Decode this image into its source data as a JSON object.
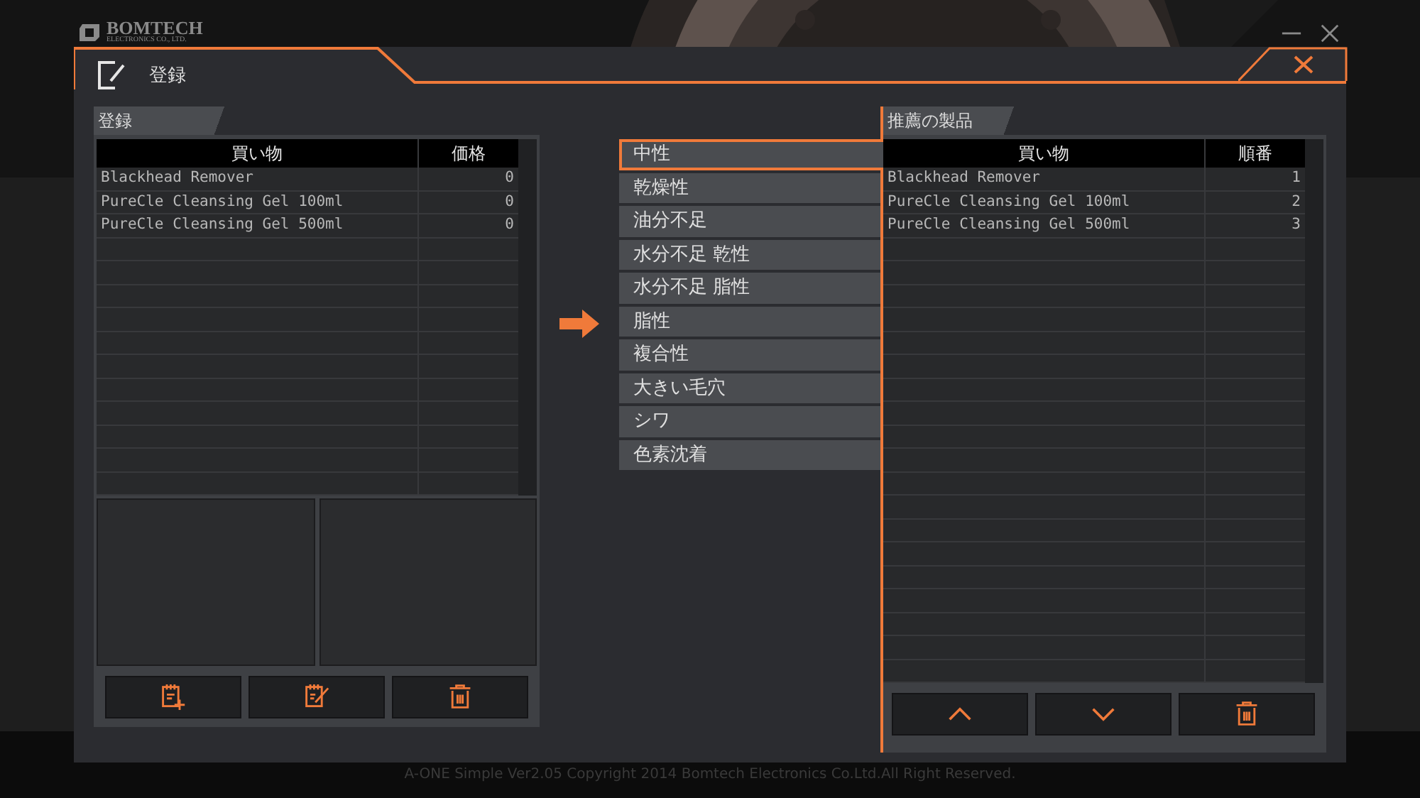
{
  "app": {
    "logo": "BOMTECH",
    "logo_subtitle": "ELECTRONICS CO., LTD."
  },
  "dialog": {
    "title": "登録"
  },
  "left_panel": {
    "tab": "登録",
    "columns": [
      "買い物",
      "価格"
    ],
    "rows": [
      {
        "name": "Blackhead Remover",
        "value": "0"
      },
      {
        "name": "PureCle Cleansing Gel 100ml",
        "value": "0"
      },
      {
        "name": "PureCle Cleansing Gel 500ml",
        "value": "0"
      }
    ],
    "buttons": [
      {
        "kind": "add"
      },
      {
        "kind": "edit"
      },
      {
        "kind": "delete"
      }
    ]
  },
  "skin_types": [
    {
      "label": "中性",
      "selected": true
    },
    {
      "label": "乾燥性",
      "selected": false
    },
    {
      "label": "油分不足",
      "selected": false
    },
    {
      "label": "水分不足 乾性",
      "selected": false
    },
    {
      "label": "水分不足 脂性",
      "selected": false
    },
    {
      "label": "脂性",
      "selected": false
    },
    {
      "label": "複合性",
      "selected": false
    },
    {
      "label": "大きい毛穴",
      "selected": false
    },
    {
      "label": "シワ",
      "selected": false
    },
    {
      "label": "色素沈着",
      "selected": false
    }
  ],
  "right_panel": {
    "tab": "推薦の製品",
    "columns": [
      "買い物",
      "順番"
    ],
    "rows": [
      {
        "name": "Blackhead Remover",
        "value": "1"
      },
      {
        "name": "PureCle Cleansing Gel 100ml",
        "value": "2"
      },
      {
        "name": "PureCle Cleansing Gel 500ml",
        "value": "3"
      }
    ],
    "buttons": [
      {
        "kind": "up"
      },
      {
        "kind": "down"
      },
      {
        "kind": "delete"
      }
    ]
  },
  "footer": "A-ONE Simple Ver2.05 Copyright 2014 Bomtech Electronics Co.Ltd.All Right Reserved."
}
